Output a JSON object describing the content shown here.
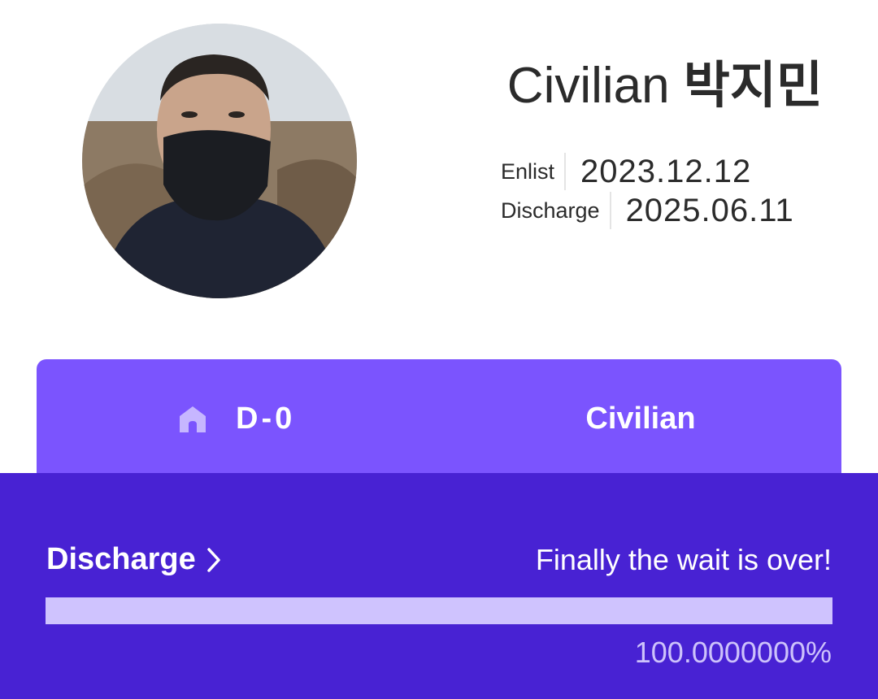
{
  "profile": {
    "name_prefix": "Civilian",
    "name_korean": "박지민",
    "avatar_alt": "profile photo"
  },
  "dates": {
    "enlist_label": "Enlist",
    "enlist_value": "2023.12.12",
    "discharge_label": "Discharge",
    "discharge_value": "2025.06.11"
  },
  "status": {
    "icon": "home-icon",
    "dday": "D-0",
    "rank": "Civilian"
  },
  "discharge": {
    "link_label": "Discharge",
    "link_icon": "chevron-right-icon",
    "message": "Finally the wait is over!",
    "progress_fraction": 1.0,
    "percent_text": "100.0000000%"
  },
  "colors": {
    "accent": "#7b54fe",
    "panel": "#4822d3",
    "progress_fill": "#cfc3fe"
  }
}
